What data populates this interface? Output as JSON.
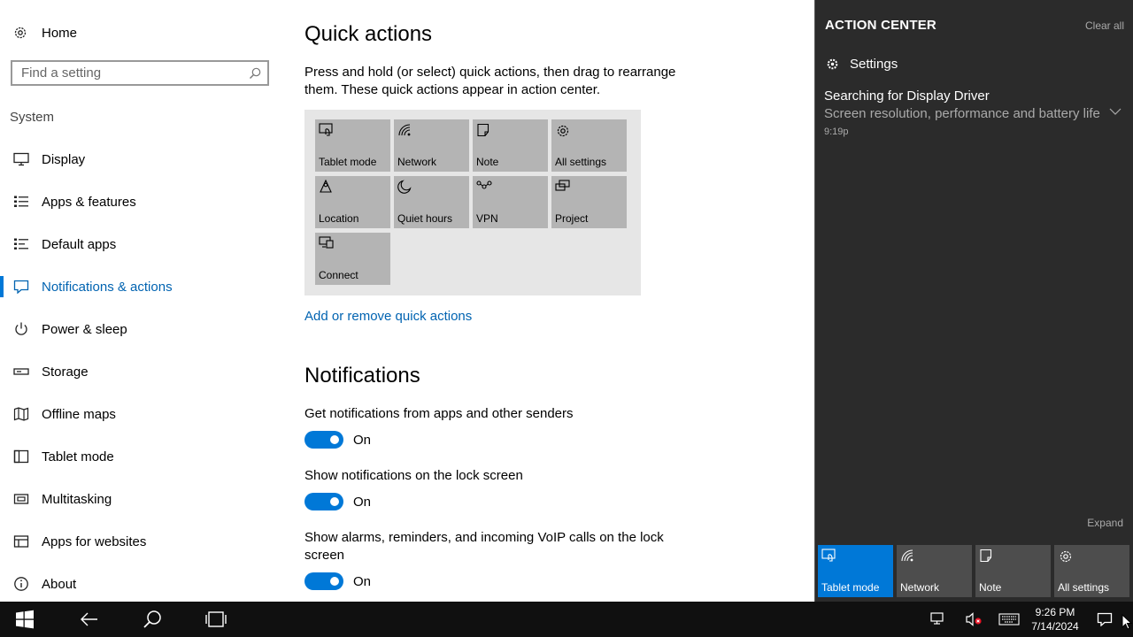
{
  "nav": {
    "home": "Home",
    "search_placeholder": "Find a setting",
    "group": "System",
    "items": [
      {
        "label": "Display",
        "icon": "monitor-icon"
      },
      {
        "label": "Apps & features",
        "icon": "list-icon"
      },
      {
        "label": "Default apps",
        "icon": "list-default-icon"
      },
      {
        "label": "Notifications & actions",
        "icon": "notification-icon",
        "selected": true
      },
      {
        "label": "Power & sleep",
        "icon": "power-icon"
      },
      {
        "label": "Storage",
        "icon": "storage-icon"
      },
      {
        "label": "Offline maps",
        "icon": "map-icon"
      },
      {
        "label": "Tablet mode",
        "icon": "tablet-icon"
      },
      {
        "label": "Multitasking",
        "icon": "multitasking-icon"
      },
      {
        "label": "Apps for websites",
        "icon": "apps-websites-icon"
      },
      {
        "label": "About",
        "icon": "info-icon"
      }
    ]
  },
  "main": {
    "quick_actions_title": "Quick actions",
    "quick_actions_desc": "Press and hold (or select) quick actions, then drag to rearrange them. These quick actions appear in action center.",
    "tiles": [
      {
        "label": "Tablet mode",
        "icon": "tablet-mode-icon"
      },
      {
        "label": "Network",
        "icon": "network-icon"
      },
      {
        "label": "Note",
        "icon": "note-icon"
      },
      {
        "label": "All settings",
        "icon": "gear-icon"
      },
      {
        "label": "Location",
        "icon": "location-icon"
      },
      {
        "label": "Quiet hours",
        "icon": "moon-icon"
      },
      {
        "label": "VPN",
        "icon": "vpn-icon"
      },
      {
        "label": "Project",
        "icon": "project-icon"
      },
      {
        "label": "Connect",
        "icon": "connect-icon"
      }
    ],
    "add_remove_link": "Add or remove quick actions",
    "notifications_title": "Notifications",
    "settings": [
      {
        "label": "Get notifications from apps and other senders",
        "state": "On"
      },
      {
        "label": "Show notifications on the lock screen",
        "state": "On"
      },
      {
        "label": "Show alarms, reminders, and incoming VoIP calls on the lock screen",
        "state": "On"
      }
    ]
  },
  "action_center": {
    "title": "ACTION CENTER",
    "clear_all": "Clear all",
    "app_name": "Settings",
    "notification": {
      "title": "Searching for Display Driver",
      "body": "Screen resolution, performance and battery life",
      "time": "9:19p"
    },
    "expand": "Expand",
    "tiles": [
      {
        "label": "Tablet mode",
        "active": true
      },
      {
        "label": "Network",
        "active": false
      },
      {
        "label": "Note",
        "active": false
      },
      {
        "label": "All settings",
        "active": false
      }
    ],
    "accent_color": "#0078d7"
  },
  "taskbar": {
    "time": "9:26 PM",
    "date": "7/14/2024"
  }
}
